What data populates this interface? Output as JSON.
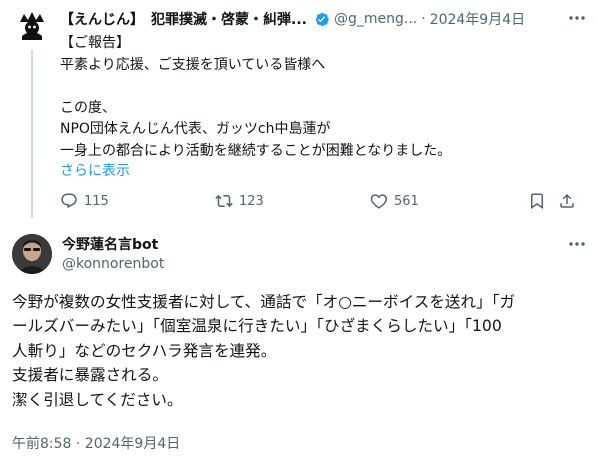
{
  "parent_tweet": {
    "display_name": "【えんじん】　犯罪撲滅・啓蒙・糾弾...",
    "handle": "@g_meng...",
    "separator": "·",
    "date": "2024年9月4日",
    "body_lines": [
      "【ご報告】",
      "平素より応援、ご支援を頂いている皆様へ",
      "",
      "この度、",
      "NPO団体えんじん代表、ガッツch中島蓮が",
      "一身上の都合により活動を継続することが困難となりました。"
    ],
    "show_more": "さらに表示",
    "reply_count": "115",
    "retweet_count": "123",
    "like_count": "561",
    "accent_color": "#1d9bf0"
  },
  "main_tweet": {
    "display_name": "今野蓮名言bot",
    "handle": "@konnorenbot",
    "body_lines": [
      "今野が複数の女性支援者に対して、通話で「オ○ニーボイスを送れ」「ガ",
      "ールズバーみたい」「個室温泉に行きたい」「ひざまくらしたい」「100",
      "人斬り」などのセクハラ発言を連発。",
      "支援者に暴露される。",
      "潔く引退してください。"
    ],
    "timestamp": "午前8:58 · 2024年9月4日"
  },
  "icons": {
    "verified": "verified-badge-icon",
    "more": "more-options-icon",
    "reply": "reply-icon",
    "retweet": "retweet-icon",
    "like": "like-icon",
    "bookmark": "bookmark-icon",
    "share": "share-icon"
  }
}
